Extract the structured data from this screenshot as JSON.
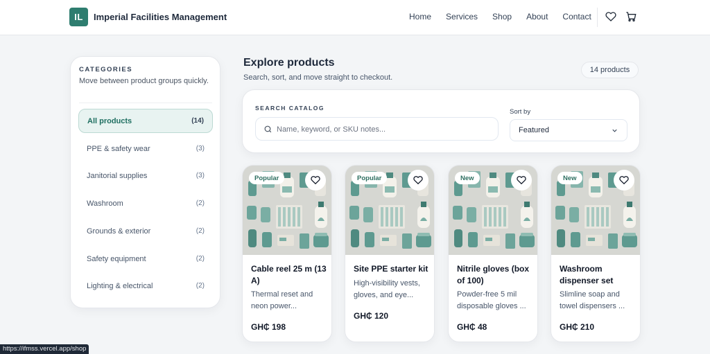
{
  "brand": {
    "logo_text": "IL",
    "name": "Imperial Facilities Management",
    "color": "#2e7d6f"
  },
  "nav": {
    "items": [
      "Home",
      "Services",
      "Shop",
      "About",
      "Contact"
    ]
  },
  "header_icons": [
    "heart-icon",
    "cart-icon"
  ],
  "sidebar": {
    "title": "CATEGORIES",
    "subtitle": "Move between product groups quickly.",
    "items": [
      {
        "label": "All products",
        "count": "(14)",
        "active": true
      },
      {
        "label": "PPE & safety wear",
        "count": "(3)"
      },
      {
        "label": "Janitorial supplies",
        "count": "(3)"
      },
      {
        "label": "Washroom",
        "count": "(2)"
      },
      {
        "label": "Grounds & exterior",
        "count": "(2)"
      },
      {
        "label": "Safety equipment",
        "count": "(2)"
      },
      {
        "label": "Lighting & electrical",
        "count": "(2)"
      }
    ]
  },
  "main": {
    "title": "Explore products",
    "subtitle": "Search, sort, and move straight to checkout.",
    "count": "14 products"
  },
  "search": {
    "label": "SEARCH CATALOG",
    "placeholder": "Name, keyword, or SKU notes...",
    "value": "",
    "sort_label": "Sort by",
    "sort_value": "Featured"
  },
  "products": [
    {
      "badge": "Popular",
      "name": "Cable reel 25 m (13 A)",
      "desc": "Thermal reset and neon power...",
      "price": "GH₵ 198"
    },
    {
      "badge": "Popular",
      "name": "Site PPE starter kit",
      "desc": "High-visibility vests, gloves, and eye...",
      "price": "GH₵ 120"
    },
    {
      "badge": "New",
      "name": "Nitrile gloves (box of 100)",
      "desc": "Powder-free 5 mil disposable gloves ...",
      "price": "GH₵ 48"
    },
    {
      "badge": "New",
      "name": "Washroom dispenser set",
      "desc": "Slimline soap and towel dispensers ...",
      "price": "GH₵ 210"
    }
  ],
  "status_bar": {
    "url": "https://ifmss.vercel.app/shop"
  }
}
